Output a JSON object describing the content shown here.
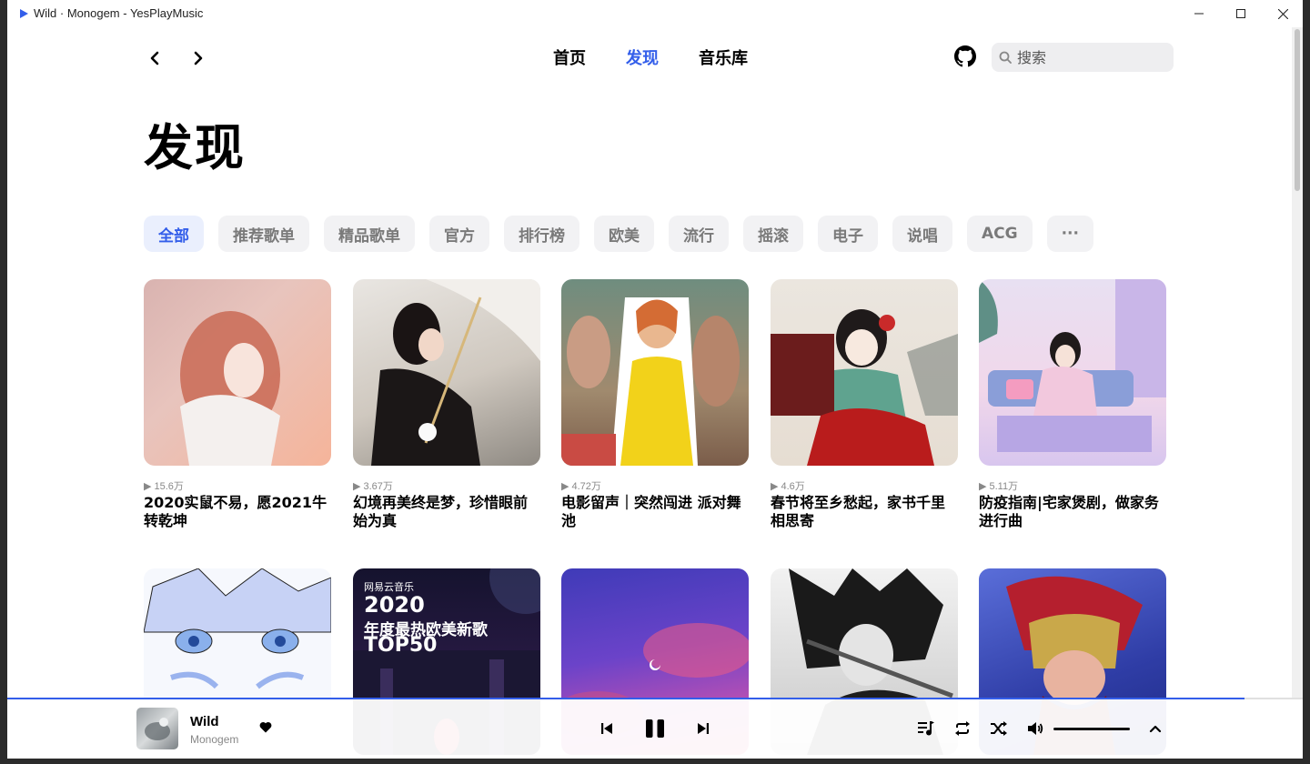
{
  "window": {
    "title": "Wild · Monogem - YesPlayMusic"
  },
  "nav": {
    "links": [
      "首页",
      "发现",
      "音乐库"
    ],
    "active_index": 1,
    "search_placeholder": "搜索"
  },
  "page": {
    "title": "发现"
  },
  "categories": [
    {
      "label": "全部",
      "active": true
    },
    {
      "label": "推荐歌单"
    },
    {
      "label": "精品歌单"
    },
    {
      "label": "官方"
    },
    {
      "label": "排行榜"
    },
    {
      "label": "欧美"
    },
    {
      "label": "流行"
    },
    {
      "label": "摇滚"
    },
    {
      "label": "电子"
    },
    {
      "label": "说唱"
    },
    {
      "label": "ACG"
    },
    {
      "label": "···"
    }
  ],
  "playlists": [
    {
      "play_count": "15.6万",
      "title": "2020实鼠不易，愿2021牛转乾坤"
    },
    {
      "play_count": "3.67万",
      "title": "幻境再美终是梦，珍惜眼前始为真"
    },
    {
      "play_count": "4.72万",
      "title": "电影留声｜突然闯进 派对舞池"
    },
    {
      "play_count": "4.6万",
      "title": "春节将至乡愁起，家书千里相思寄"
    },
    {
      "play_count": "5.11万",
      "title": "防疫指南|宅家煲剧，做家务进行曲"
    },
    {
      "play_count": "",
      "title": ""
    },
    {
      "play_count": "",
      "title": "",
      "cover_text": [
        "网易云音乐",
        "2020",
        "年度最热欧美新歌",
        "TOP50"
      ]
    },
    {
      "play_count": "",
      "title": ""
    },
    {
      "play_count": "",
      "title": ""
    },
    {
      "play_count": "",
      "title": ""
    }
  ],
  "player": {
    "song": "Wild",
    "artist": "Monogem",
    "progress": 0.955,
    "volume": 1.0,
    "is_playing": true
  },
  "colors": {
    "accent": "#335eea"
  }
}
